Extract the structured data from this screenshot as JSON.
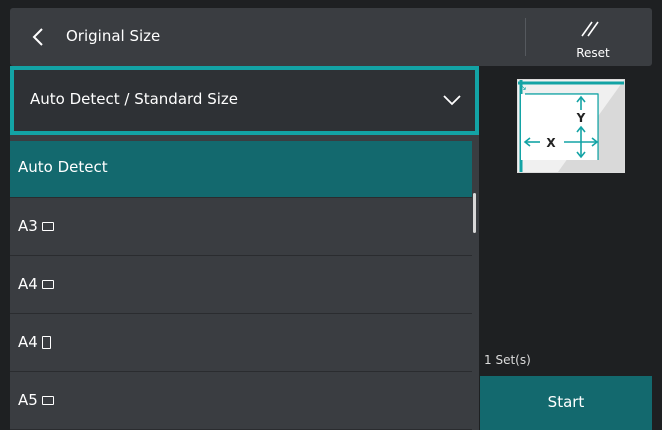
{
  "header": {
    "title": "Original Size",
    "reset_label": "Reset",
    "back_icon": "chevron-left-icon",
    "reset_icon": "double-slash-icon"
  },
  "dropdown": {
    "selected_value": "Auto Detect / Standard Size",
    "chevron_icon": "chevron-down-icon"
  },
  "options": [
    {
      "label": "Auto Detect",
      "orientation": "",
      "selected": true
    },
    {
      "label": "A3",
      "orientation": "landscape",
      "selected": false
    },
    {
      "label": "A4",
      "orientation": "landscape",
      "selected": false
    },
    {
      "label": "A4",
      "orientation": "portrait",
      "selected": false
    },
    {
      "label": "A5",
      "orientation": "landscape",
      "selected": false
    }
  ],
  "preview": {
    "x_label": "X",
    "y_label": "Y"
  },
  "sets_label": "1 Set(s)",
  "start_label": "Start",
  "colors": {
    "accent": "#13a3a5",
    "selected_row": "#13696e",
    "panel": "#3a3d41",
    "background": "#1e2022"
  }
}
